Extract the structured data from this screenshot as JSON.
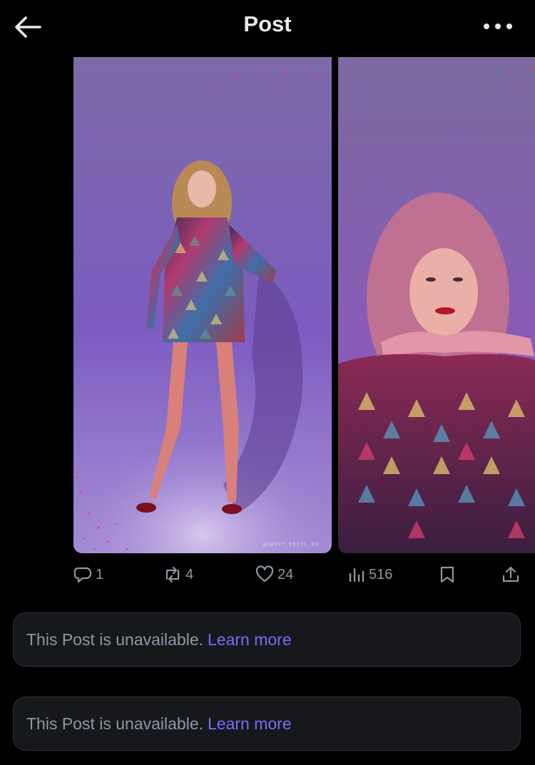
{
  "header": {
    "title": "Post",
    "back_icon": "arrow-left-icon",
    "more_icon": "more-dots-icon"
  },
  "media": {
    "images": [
      {
        "description": "photo-full-body-sequin-dress",
        "watermark": "@SWIFT_EDITS_89"
      },
      {
        "description": "photo-portrait-hands-under-chin"
      }
    ]
  },
  "actions": {
    "reply": {
      "icon": "reply-icon",
      "count": "1"
    },
    "repost": {
      "icon": "repost-icon",
      "count": "4"
    },
    "like": {
      "icon": "heart-icon",
      "count": "24"
    },
    "views": {
      "icon": "views-chart-icon",
      "count": "516"
    },
    "bookmark": {
      "icon": "bookmark-icon"
    },
    "share": {
      "icon": "share-icon"
    }
  },
  "unavailable_posts": [
    {
      "message": "This Post is unavailable.",
      "link": "Learn more"
    },
    {
      "message": "This Post is unavailable.",
      "link": "Learn more"
    }
  ],
  "colors": {
    "background": "#000000",
    "text_primary": "#e7e9ea",
    "text_secondary": "#8b98a5",
    "link": "#7b6cf5",
    "card_bg": "#16181c",
    "card_border": "#2f3336"
  }
}
